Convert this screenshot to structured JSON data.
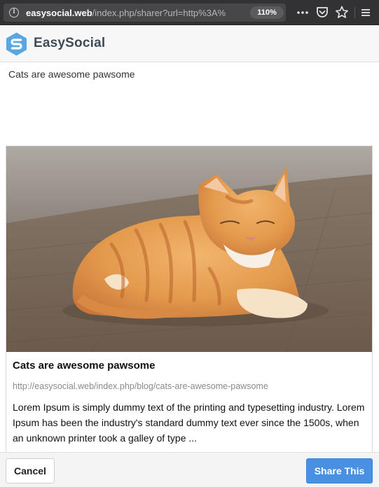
{
  "browser": {
    "url_domain": "easysocial.web",
    "url_path": "/index.php/sharer?url=http%3A%",
    "zoom": "110%",
    "icons": [
      "info-icon",
      "more-icon",
      "pocket-icon",
      "star-icon",
      "menu-icon"
    ]
  },
  "app": {
    "brand": "EasySocial",
    "brand_color": "#3e4a57",
    "logo_color": "#5aa6de"
  },
  "message": "Cats are awesome pawsome",
  "preview": {
    "image": "orange tabby cat lying on wooden floor",
    "title": "Cats are awesome pawsome",
    "url": "http://easysocial.web/index.php/blog/cats-are-awesome-pawsome",
    "description": "Lorem Ipsum is simply dummy text of the printing and typesetting industry. Lorem Ipsum has been the industry's standard dummy text ever since the 1500s, when an unknown printer took a galley of type ..."
  },
  "actions": {
    "cancel_label": "Cancel",
    "share_label": "Share This",
    "share_color": "#4a90e2"
  }
}
